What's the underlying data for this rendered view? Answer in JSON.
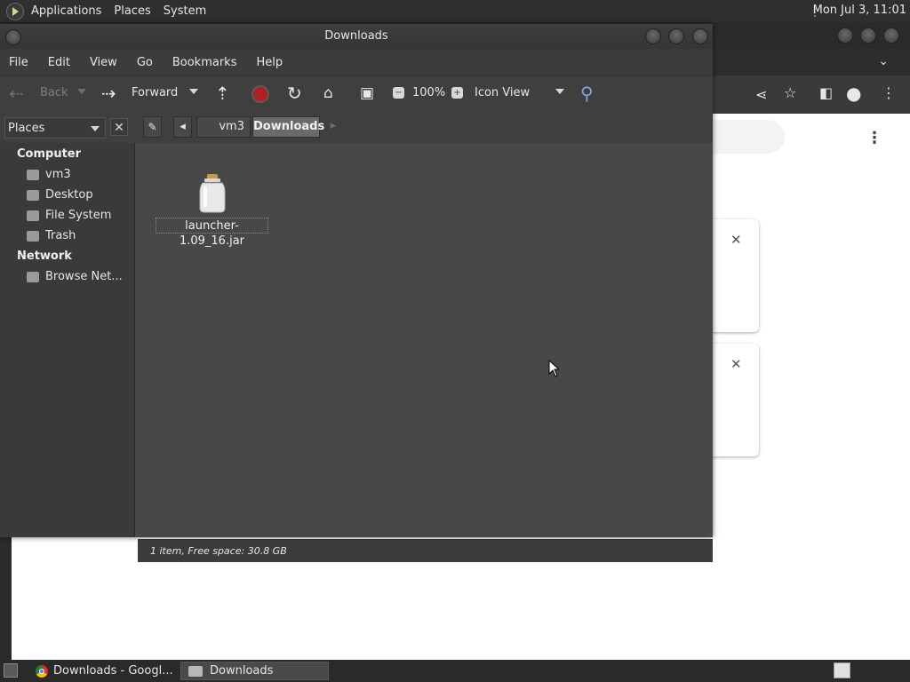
{
  "top_panel": {
    "menus": [
      "Applications",
      "Places",
      "System"
    ],
    "clock": "Mon Jul  3, 11:01"
  },
  "file_manager": {
    "title": "Downloads",
    "menubar": [
      "File",
      "Edit",
      "View",
      "Go",
      "Bookmarks",
      "Help"
    ],
    "toolbar": {
      "back_label": "Back",
      "forward_label": "Forward",
      "zoom": "100%",
      "view_mode": "Icon View"
    },
    "sidebar_combo": "Places",
    "path": [
      "vm3",
      "Downloads"
    ],
    "sidebar": {
      "sections": [
        {
          "title": "Computer",
          "items": [
            "vm3",
            "Desktop",
            "File System",
            "Trash"
          ]
        },
        {
          "title": "Network",
          "items": [
            "Browse Net..."
          ]
        }
      ]
    },
    "files": [
      {
        "name": "launcher-1.09_16.jar",
        "icon": "jar-icon"
      }
    ],
    "status": "1 item, Free space: 30.8 GB"
  },
  "taskbar": {
    "tasks": [
      {
        "label": "Downloads - Googl...",
        "icon": "chrome-icon",
        "active": false
      },
      {
        "label": "Downloads",
        "icon": "folder-icon",
        "active": true
      }
    ]
  }
}
